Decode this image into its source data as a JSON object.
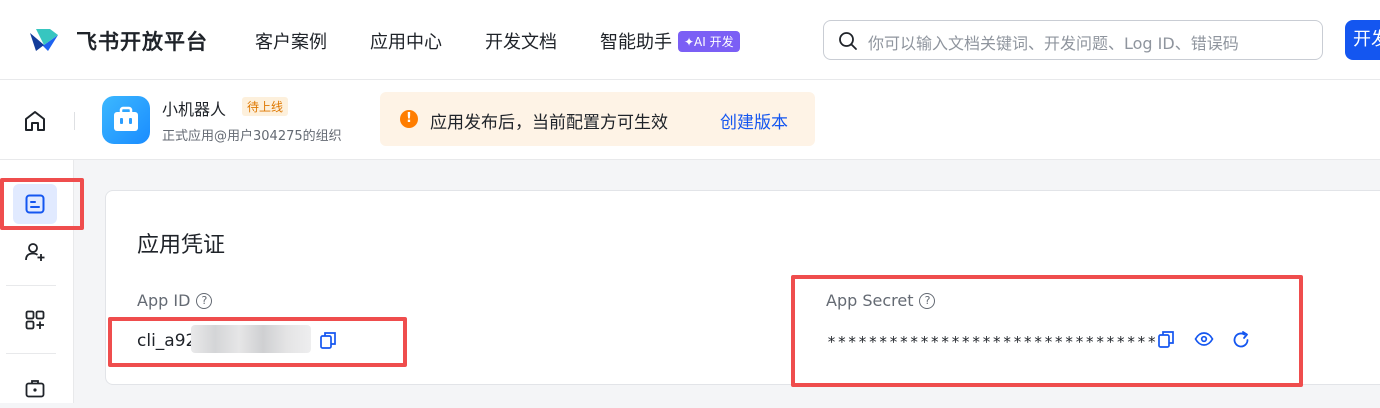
{
  "topnav": {
    "brand": "飞书开放平台",
    "links": [
      "客户案例",
      "应用中心",
      "开发文档",
      "智能助手"
    ],
    "ai_badge": "✦AI 开发",
    "search_placeholder": "你可以输入文档关键词、开发问题、Log ID、错误码",
    "cta_label": "开发者后台"
  },
  "appbar": {
    "app_name": "小机器人",
    "status": "待上线",
    "org": "正式应用@用户304275的组织",
    "notice": "应用发布后，当前配置方可生效",
    "notice_link": "创建版本"
  },
  "card": {
    "title": "应用凭证",
    "app_id_label": "App ID",
    "app_id_visible": "cli_a92",
    "app_secret_label": "App Secret",
    "app_secret_masked": "********************************"
  },
  "colors": {
    "accent": "#1456f0",
    "highlight": "#ef4d4d",
    "warning": "#ff7d00",
    "ai_badge": "#7b5ff5"
  },
  "icons": [
    "search-icon",
    "home-icon",
    "credentials-icon",
    "add-member-icon",
    "apps-add-icon",
    "toolbox-icon",
    "help-icon",
    "copy-icon",
    "eye-icon",
    "refresh-icon"
  ]
}
